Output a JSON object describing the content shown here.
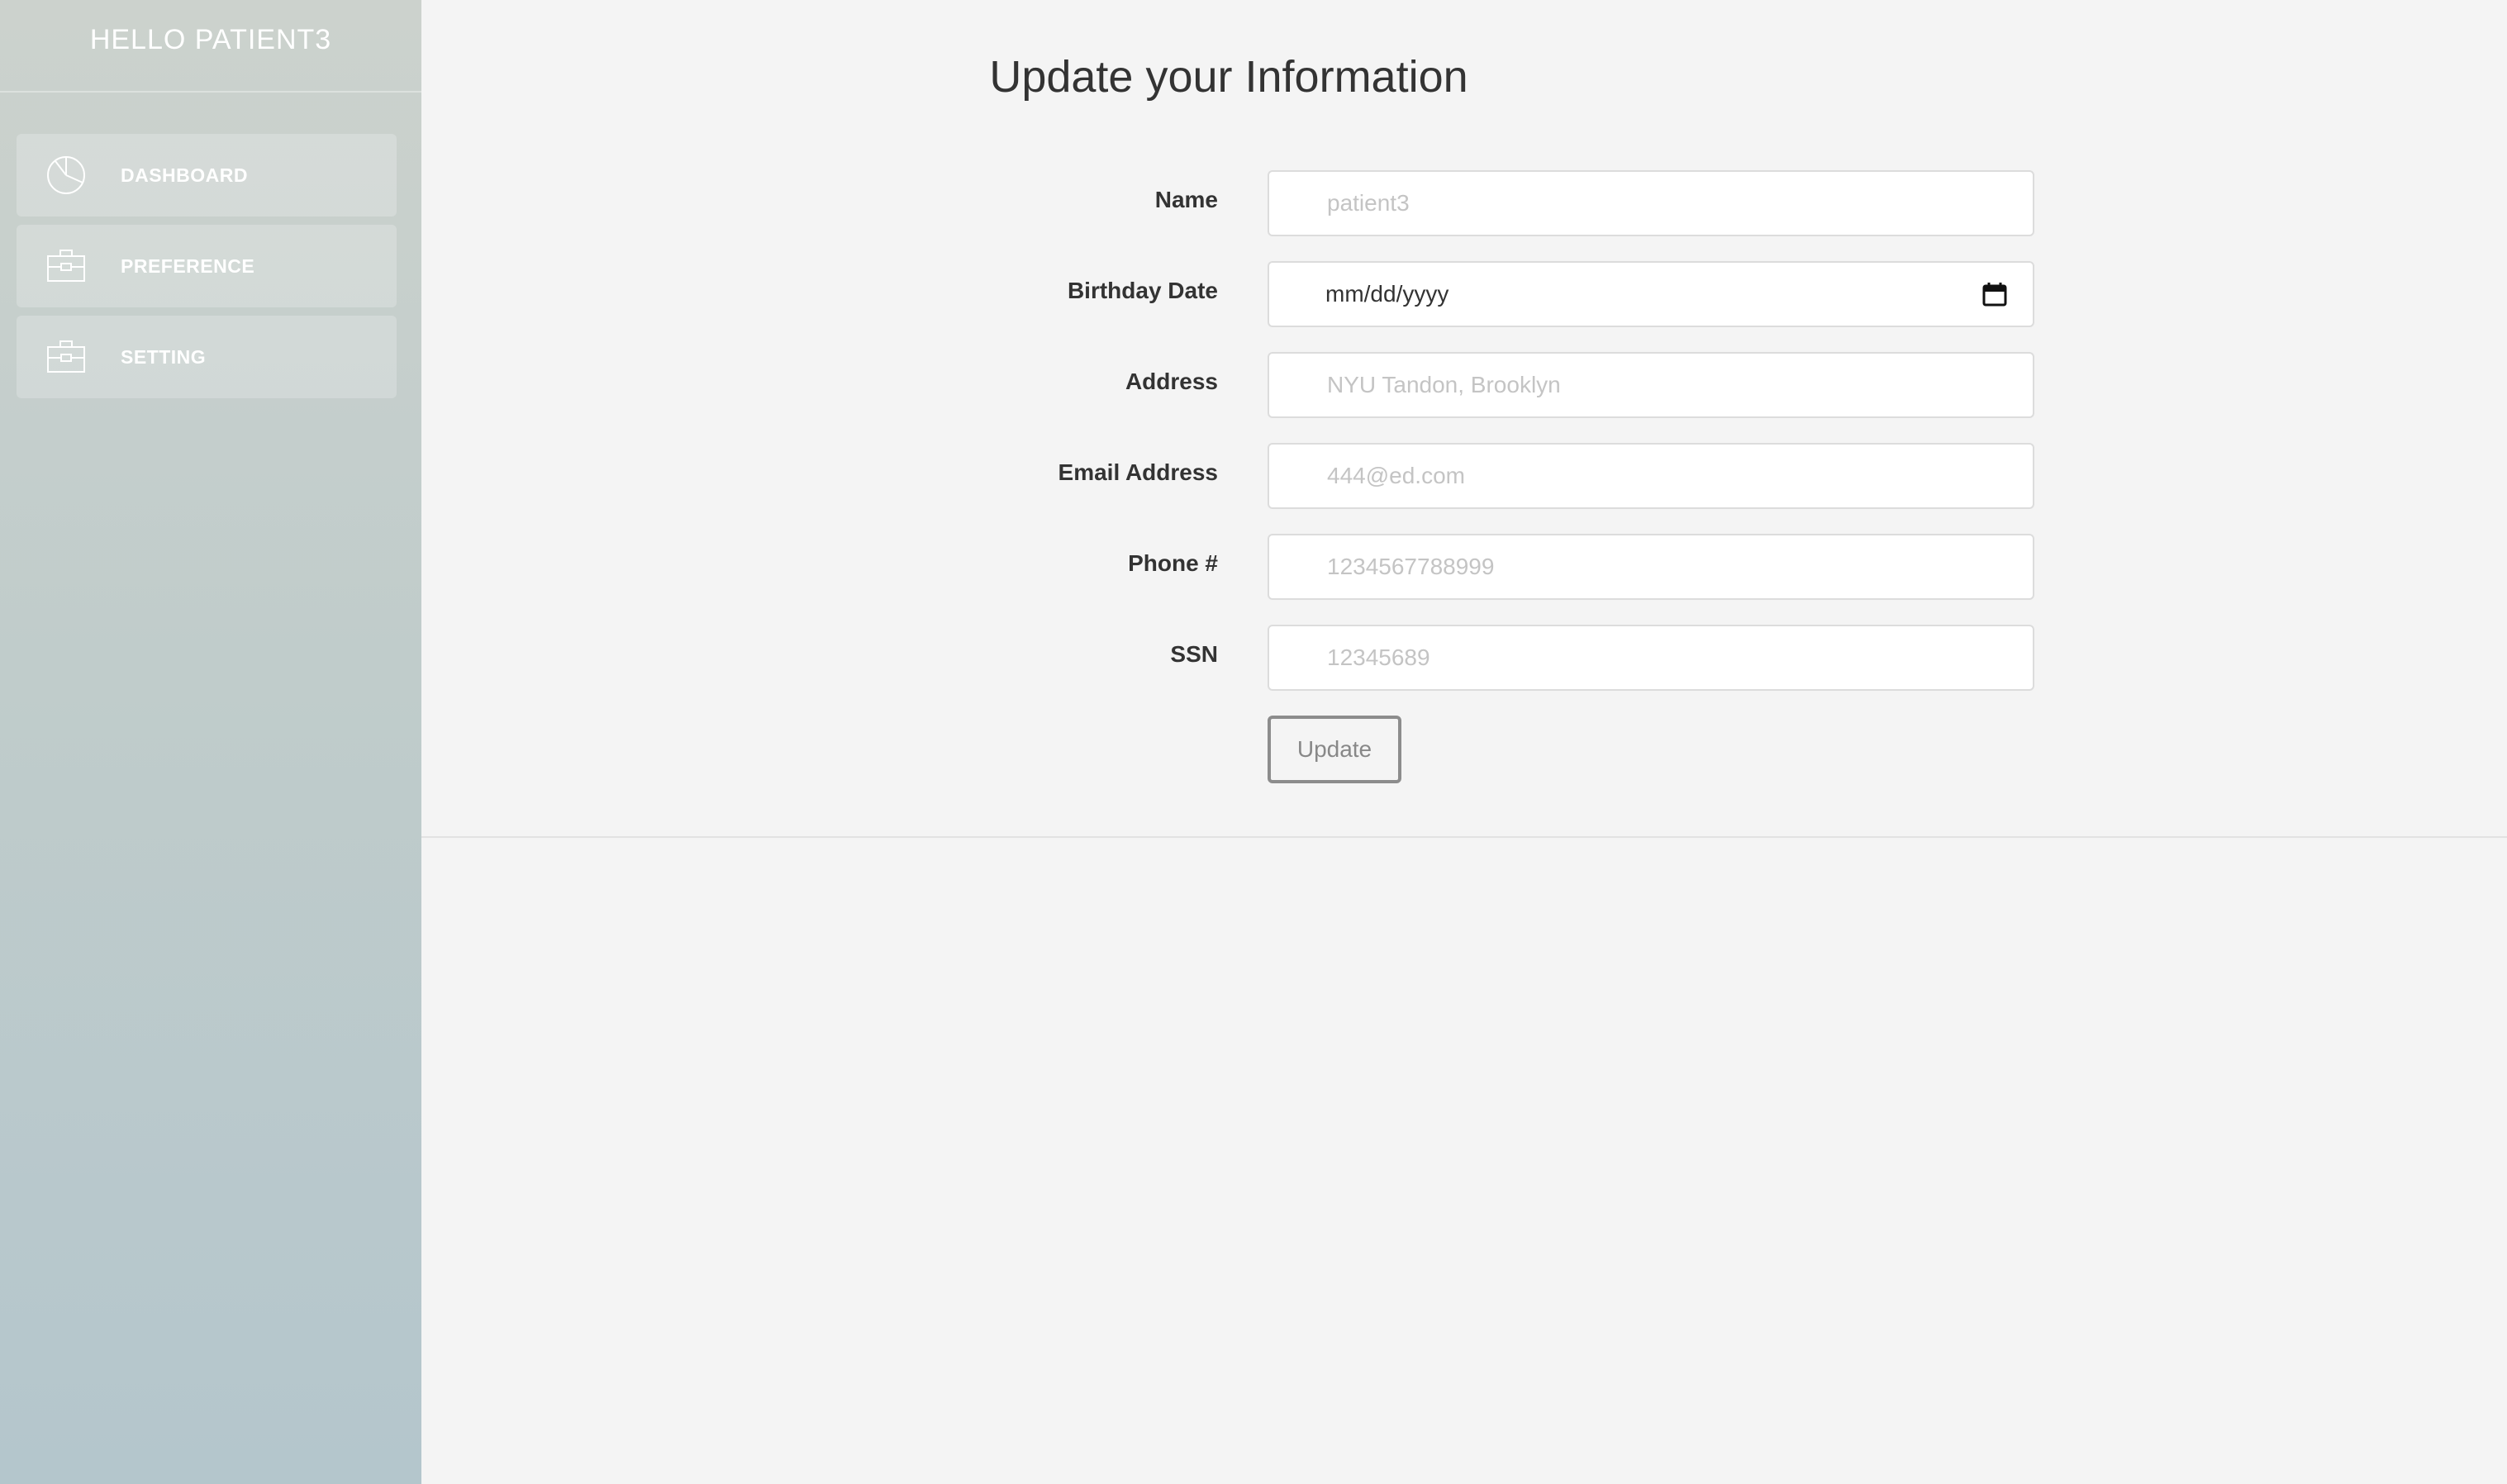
{
  "sidebar": {
    "title": "HELLO PATIENT3",
    "items": [
      {
        "label": "DASHBOARD",
        "icon": "pie-chart-icon"
      },
      {
        "label": "PREFERENCE",
        "icon": "briefcase-icon"
      },
      {
        "label": "SETTING",
        "icon": "briefcase-icon"
      }
    ]
  },
  "main": {
    "title": "Update your Information",
    "form": {
      "name": {
        "label": "Name",
        "placeholder": "patient3"
      },
      "birthday": {
        "label": "Birthday Date",
        "value": "mm/dd/yyyy"
      },
      "address": {
        "label": "Address",
        "placeholder": "NYU Tandon, Brooklyn"
      },
      "email": {
        "label": "Email Address",
        "placeholder": "444@ed.com"
      },
      "phone": {
        "label": "Phone #",
        "placeholder": "1234567788999"
      },
      "ssn": {
        "label": "SSN",
        "placeholder": "12345689"
      },
      "submit_label": "Update"
    }
  },
  "colors": {
    "sidebar_top": "#ccd2cd",
    "sidebar_bottom": "#b4c6cc",
    "background": "#f4f4f4",
    "button_border": "#8c8c8c"
  }
}
